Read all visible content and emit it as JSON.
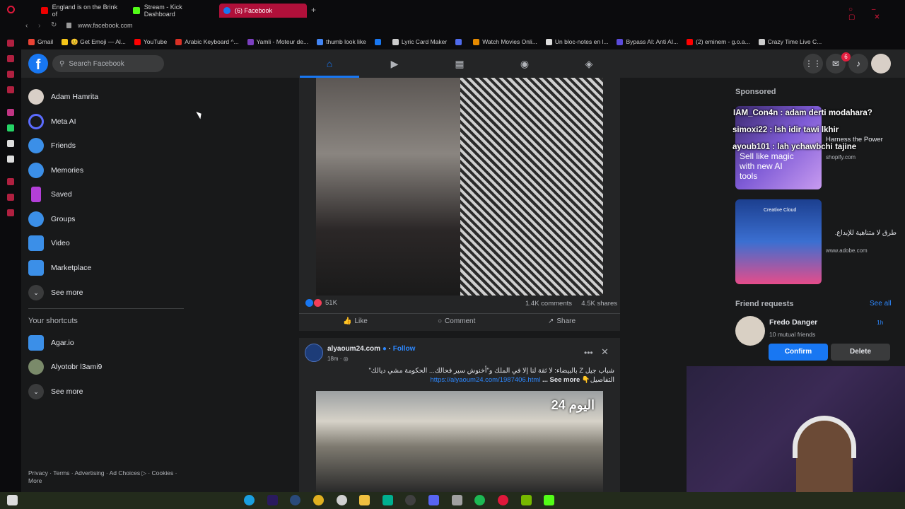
{
  "browser": {
    "tabs": [
      {
        "label": "England is on the Brink of",
        "color": "#e00"
      },
      {
        "label": "Stream - Kick Dashboard",
        "color": "#53fc18"
      },
      {
        "label": "(6) Facebook",
        "color": "#1877f2"
      }
    ],
    "new_tab": "+",
    "url": "www.facebook.com",
    "bookmarks": [
      {
        "label": "Gmail",
        "color": "#ea4335"
      },
      {
        "label": "😊 Get Emoji — Al...",
        "color": "#f5c518"
      },
      {
        "label": "YouTube",
        "color": "#ff0000"
      },
      {
        "label": "Arabic Keyboard ^...",
        "color": "#d93025"
      },
      {
        "label": "Yamli - Moteur de...",
        "color": "#7b3fbf"
      },
      {
        "label": "thumb look like",
        "color": "#4285f4"
      },
      {
        "label": "",
        "color": "#1877f2"
      },
      {
        "label": "Lyric Card Maker",
        "color": "#cccccc"
      },
      {
        "label": "",
        "color": "#4f6bed"
      },
      {
        "label": "Watch Movies Onli...",
        "color": "#e68a00"
      },
      {
        "label": "Un bloc-notes en l...",
        "color": "#dddddd"
      },
      {
        "label": "Bypass AI: Anti AI...",
        "color": "#5b4bdb"
      },
      {
        "label": "(2) eminem - g.o.a...",
        "color": "#ff0000"
      },
      {
        "label": "Crazy Time Live C...",
        "color": "#cccccc"
      }
    ]
  },
  "fb": {
    "logo": "f",
    "search_placeholder": "Search Facebook",
    "notif_count": "6",
    "left_nav": [
      {
        "label": "Adam Hamrita",
        "icon": "avatar",
        "color": "#d8cfc7"
      },
      {
        "label": "Meta AI",
        "icon": "meta-ai-icon",
        "color": "#5b6cff"
      },
      {
        "label": "Friends",
        "icon": "friends-icon",
        "color": "#3b8fe8"
      },
      {
        "label": "Memories",
        "icon": "clock-icon",
        "color": "#3b8fe8"
      },
      {
        "label": "Saved",
        "icon": "bookmark-icon",
        "color": "#b33fd8"
      },
      {
        "label": "Groups",
        "icon": "groups-icon",
        "color": "#3b8fe8"
      },
      {
        "label": "Video",
        "icon": "video-icon",
        "color": "#3b8fe8"
      },
      {
        "label": "Marketplace",
        "icon": "marketplace-icon",
        "color": "#3b8fe8"
      },
      {
        "label": "See more",
        "icon": "chevron-down-icon",
        "color": "#3a3b3c"
      }
    ],
    "shortcuts_heading": "Your shortcuts",
    "shortcuts": [
      {
        "label": "Agar.io",
        "color": "#3b8fe8"
      },
      {
        "label": "Alyotobr l3ami9",
        "color": "#7a8a6a"
      },
      {
        "label": "See more",
        "color": "#3a3b3c"
      }
    ],
    "footer": "Privacy · Terms · Advertising · Ad Choices ▷ · Cookies · More",
    "post1": {
      "reaction_count": "51K",
      "comments": "1.4K comments",
      "shares": "4.5K shares",
      "like": "Like",
      "comment": "Comment",
      "share": "Share"
    },
    "post2": {
      "page_name": "alyaoum24.com",
      "follow": "Follow",
      "time": "18m · ",
      "text": "شباب جيل Z بالبيضاء: لا ثقة لنا إلا في الملك و\"أخنوش سير فحالك... الحكومة مشي ديالك\"",
      "text2_prefix": "التفاصيل👇 ",
      "link": "https://alyaoum24.com/1987406.html",
      "see_more": "... See more",
      "image_caption": "اليوم 24"
    },
    "sponsored": "Sponsored",
    "ads": [
      {
        "title": "Harness the Power",
        "domain": "shopify.com",
        "img_text": "Sell like magic with new AI tools"
      },
      {
        "title": "طرق لا متناهية للإبداع.",
        "domain": "www.adobe.com",
        "img_text": "Creative Cloud"
      }
    ],
    "chat_overlay": [
      "IAM_Con4n : adam derti modahara?",
      "simoxi22 : lsh idir tawi lkhir",
      "ayoub101 : lah ychawbchi tajine"
    ],
    "friend_requests": {
      "heading": "Friend requests",
      "see_all": "See all",
      "name": "Fredo Danger",
      "time": "1h",
      "mutual": "10 mutual friends",
      "confirm": "Confirm",
      "delete": "Delete"
    }
  }
}
